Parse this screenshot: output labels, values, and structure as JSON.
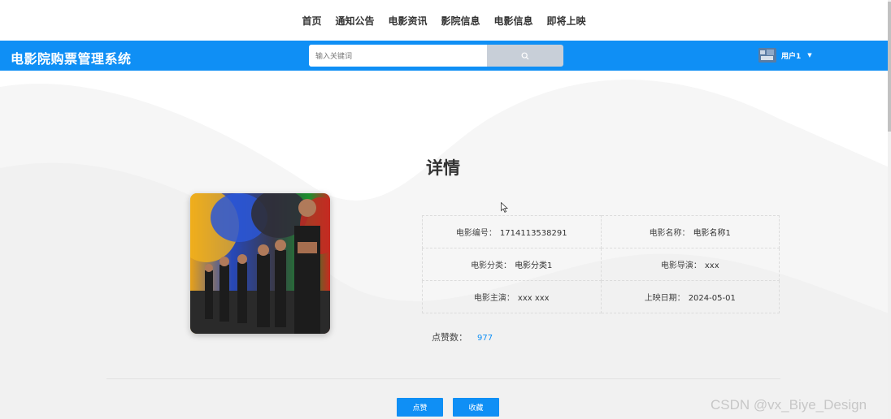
{
  "topnav": {
    "items": [
      "首页",
      "通知公告",
      "电影资讯",
      "影院信息",
      "电影信息",
      "即将上映"
    ]
  },
  "header": {
    "title": "电影院购票管理系统",
    "search_placeholder": "输入关键词",
    "search_icon": "search-icon",
    "username": "用户1",
    "accent_color": "#0f8ff5"
  },
  "detail": {
    "title": "详情",
    "fields": [
      {
        "label": "电影编号：",
        "value": "1714113538291"
      },
      {
        "label": "电影名称：",
        "value": "电影名称1"
      },
      {
        "label": "电影分类：",
        "value": "电影分类1"
      },
      {
        "label": "电影导演：",
        "value": "xxx"
      },
      {
        "label": "电影主演：",
        "value": "xxx xxx"
      },
      {
        "label": "上映日期：",
        "value": "2024-05-01"
      }
    ],
    "likes_label": "点赞数：",
    "likes_count": "977"
  },
  "actions": {
    "like_label": "点赞",
    "favorite_label": "收藏"
  },
  "watermark": "CSDN @vx_Biye_Design"
}
